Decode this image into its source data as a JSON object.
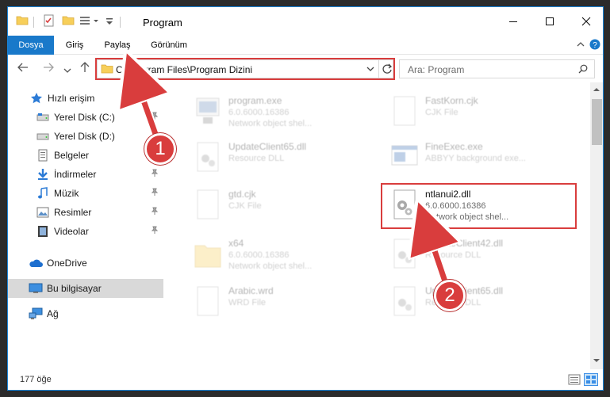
{
  "window": {
    "title": "Program",
    "controls": [
      "minimize",
      "maximize",
      "close"
    ]
  },
  "ribbon": {
    "tabs": [
      "Dosya",
      "Giriş",
      "Paylaş",
      "Görünüm"
    ],
    "active_tab": "Dosya",
    "help_icon": "help-icon"
  },
  "address": {
    "path": "C:\\Program Files\\Program Dizini",
    "search_placeholder": "Ara: Program"
  },
  "nav": {
    "quick_access": "Hızlı erişim",
    "items": [
      {
        "label": "Yerel Disk (C:)",
        "icon": "drive-icon",
        "pinned": true
      },
      {
        "label": "Yerel Disk (D:)",
        "icon": "drive-icon",
        "pinned": false
      },
      {
        "label": "Belgeler",
        "icon": "documents-icon",
        "pinned": true
      },
      {
        "label": "İndirmeler",
        "icon": "downloads-icon",
        "pinned": true
      },
      {
        "label": "Müzik",
        "icon": "music-icon",
        "pinned": true
      },
      {
        "label": "Resimler",
        "icon": "pictures-icon",
        "pinned": true
      },
      {
        "label": "Videolar",
        "icon": "videos-icon",
        "pinned": true
      }
    ],
    "onedrive": "OneDrive",
    "this_pc": "Bu bilgisayar",
    "network": "Ağ"
  },
  "files": {
    "left_column": [
      {
        "name": "program.exe",
        "line2": "6.0.6000.16386",
        "line3": "Network object shel..."
      },
      {
        "name": "UpdateClient65.dll",
        "line2": "Resource DLL",
        "line3": ""
      },
      {
        "name": "gtd.cjk",
        "line2": "CJK File",
        "line3": ""
      },
      {
        "name": "x64",
        "line2": "6.0.6000.16386",
        "line3": "Network object shel..."
      },
      {
        "name": "Arabic.wrd",
        "line2": "WRD File",
        "line3": ""
      }
    ],
    "right_column": [
      {
        "name": "FastKorn.cjk",
        "line2": "CJK File",
        "line3": ""
      },
      {
        "name": "FineExec.exe",
        "line2": "ABBYY background exe...",
        "line3": ""
      },
      {
        "name": "ntlanui2.dll",
        "line2": "6.0.6000.16386",
        "line3": "Network object shel..."
      },
      {
        "name": "UpdateClient42.dll",
        "line2": "Resource DLL",
        "line3": ""
      },
      {
        "name": "UpdateClient65.dll",
        "line2": "Resource DLL",
        "line3": ""
      }
    ]
  },
  "status": {
    "count": "177 öğe"
  },
  "annotations": {
    "step1": "1",
    "step2": "2",
    "color": "#d93d3d"
  },
  "colors": {
    "accent": "#1979ca",
    "highlight": "#d93d3d",
    "selected_nav": "#d9d9d9"
  }
}
